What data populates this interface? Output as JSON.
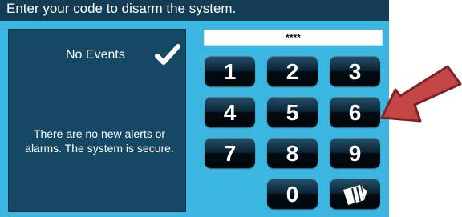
{
  "heading_fragment": "ure",
  "system_prompt": "Enter your code to disarm the system.",
  "status": {
    "title": "No Events",
    "icon": "check-icon",
    "message": "There are no new alerts or alarms. The system is secure."
  },
  "code_display": {
    "value": "****"
  },
  "keypad": {
    "keys": [
      "1",
      "2",
      "3",
      "4",
      "5",
      "6",
      "7",
      "8",
      "9",
      "0"
    ],
    "clear_icon": "eraser-icon"
  },
  "annotation": {
    "icon": "arrow-icon",
    "color": "#c54646"
  },
  "colors": {
    "titlebar": "#143d55",
    "panel": "#3ab6e0",
    "status_box": "#154864",
    "key_text": "#ffffff"
  }
}
